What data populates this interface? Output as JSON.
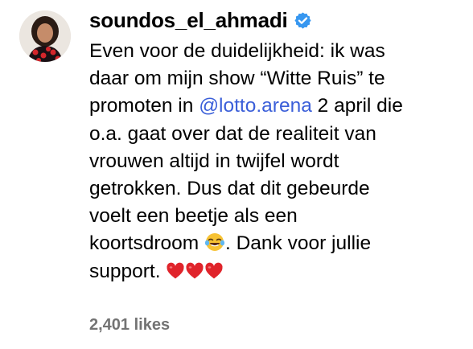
{
  "comment": {
    "username": "soundos_el_ahmadi",
    "verified_icon": "verified-badge-icon",
    "avatar_icon": "profile-avatar",
    "lines": {
      "l1": "Even voor de duidelijkheid: ik was",
      "l2": "daar om mijn show “Witte Ruis” te",
      "l3_prefix": "promoten in ",
      "l3_mention": "@lotto.arena",
      "l3_suffix": " 2 april die",
      "l4": "o.a. gaat over dat de realiteit van",
      "l5": "vrouwen altijd in twijfel wordt",
      "l6": "getrokken. Dus dat dit gebeurde",
      "l7": "voelt een beetje als een",
      "l8_prefix": "koortsdroom ",
      "l8_emoji": "face-with-tears-of-joy",
      "l8_suffix": ". Dank voor jullie",
      "l9": "support. ",
      "l9_emojis": [
        "red-heart",
        "red-heart",
        "red-heart"
      ]
    },
    "likes": "2,401 likes"
  },
  "colors": {
    "mention": "#3b5fd9",
    "verified": "#3797f0",
    "likes": "#737373",
    "heart": "#e0242b"
  }
}
